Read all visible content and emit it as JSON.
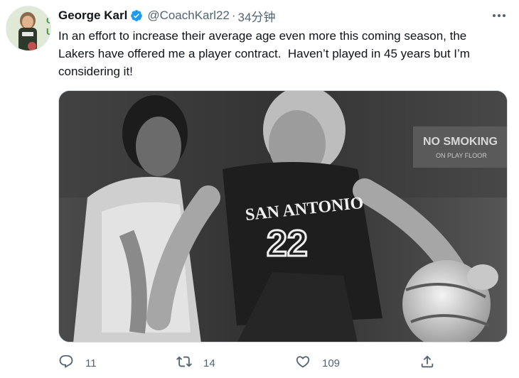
{
  "tweet": {
    "author_name": "George Karl",
    "handle": "@CoachKarl22",
    "separator": "·",
    "time": "34分钟",
    "text": "In an effort to increase their average age even more this coming season, the\nLakers have offered me a player contract.  Haven’t played in 45 years but I’m\nconsidering it!",
    "image": {
      "jersey_text": "SAN ANTONIO",
      "jersey_number": "22",
      "sign_text": "NO SMOKING",
      "sign_subtext": "ON PLAY FLOOR"
    },
    "actions": {
      "reply_count": "11",
      "retweet_count": "14",
      "like_count": "109"
    }
  },
  "colors": {
    "verified": "#1d9bf0",
    "secondary_text": "#536471",
    "primary_text": "#0f1419"
  },
  "icons": [
    "verified-badge-icon",
    "more-options-icon",
    "reply-icon",
    "retweet-icon",
    "like-icon",
    "share-icon"
  ]
}
